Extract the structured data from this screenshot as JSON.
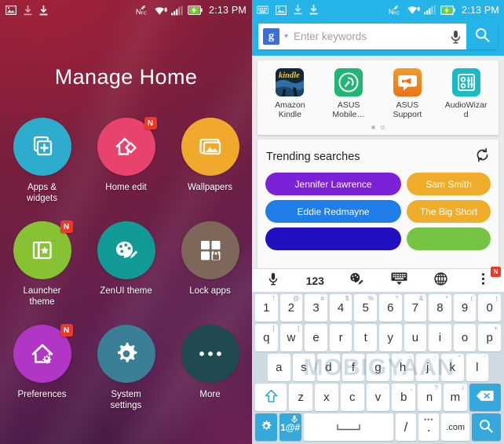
{
  "left_screen": {
    "status_bar": {
      "time": "2:13 PM",
      "left_icons": [
        "image-icon",
        "download-icon",
        "download-icon"
      ],
      "right_icons": [
        "nfc-icon",
        "wifi-icon",
        "signal-icon",
        "battery-charging-icon"
      ]
    },
    "page_title": "Manage Home",
    "tiles": [
      {
        "label": "Apps &\nwidgets",
        "label_line1": "Apps &",
        "label_line2": "widgets",
        "color": "#2eaccd",
        "icon": "add-widget-icon",
        "badge": ""
      },
      {
        "label": "Home edit",
        "label_line1": "Home edit",
        "label_line2": "",
        "color": "#e8436d",
        "icon": "home-edit-icon",
        "badge": "N"
      },
      {
        "label": "Wallpapers",
        "label_line1": "Wallpapers",
        "label_line2": "",
        "color": "#f0a92a",
        "icon": "wallpaper-icon",
        "badge": ""
      },
      {
        "label": "Launcher\ntheme",
        "label_line1": "Launcher",
        "label_line2": "theme",
        "color": "#86c232",
        "icon": "launcher-theme-icon",
        "badge": "N"
      },
      {
        "label": "ZenUI theme",
        "label_line1": "ZenUI theme",
        "label_line2": "",
        "color": "#119a96",
        "icon": "palette-icon",
        "badge": ""
      },
      {
        "label": "Lock apps",
        "label_line1": "Lock apps",
        "label_line2": "",
        "color": "#7d675a",
        "icon": "lock-apps-icon",
        "badge": ""
      },
      {
        "label": "Preferences",
        "label_line1": "Preferences",
        "label_line2": "",
        "color": "#b136c6",
        "icon": "home-settings-icon",
        "badge": "N"
      },
      {
        "label": "System\nsettings",
        "label_line1": "System",
        "label_line2": "settings",
        "color": "#3a7f95",
        "icon": "gear-icon",
        "badge": ""
      },
      {
        "label": "More",
        "label_line1": "More",
        "label_line2": "",
        "color": "#1f4a50",
        "icon": "more-dots-icon",
        "badge": ""
      }
    ]
  },
  "right_screen": {
    "status_bar": {
      "time": "2:13 PM",
      "left_icons": [
        "keyboard-icon",
        "image-icon",
        "download-icon",
        "download-icon"
      ],
      "right_icons": [
        "nfc-icon",
        "wifi-icon",
        "signal-icon",
        "battery-charging-icon"
      ],
      "background_color": "#24b4e8"
    },
    "search": {
      "engine_glyph": "g",
      "engine_badge_color": "#3b6fd4",
      "placeholder": "Enter keywords",
      "value": "",
      "mic_icon": "microphone-icon",
      "submit_icon": "search-icon",
      "dropdown_icon": "chevron-down-icon"
    },
    "app_shortcuts": {
      "items": [
        {
          "name_line1": "Amazon",
          "name_line2": "Kindle",
          "icon": "amazon-kindle-icon",
          "color": "#1b2a3c",
          "glyph": "kindle"
        },
        {
          "name_line1": "ASUS",
          "name_line2": "Mobile…",
          "icon": "asus-mobile-manager-icon",
          "color": "#22b573"
        },
        {
          "name_line1": "ASUS",
          "name_line2": "Support",
          "icon": "asus-support-icon",
          "color": "#f08421"
        },
        {
          "name_line1": "AudioWizar",
          "name_line2": "d",
          "icon": "audiowizard-icon",
          "color": "#19bcc4"
        }
      ],
      "page_dots": 2,
      "active_dot": 0
    },
    "trending": {
      "title": "Trending searches",
      "refresh_icon": "refresh-icon",
      "left_chips": [
        {
          "label": "Jennifer Lawrence",
          "color": "#7b22d8"
        },
        {
          "label": "Eddie Redmayne",
          "color": "#1f7ee8"
        },
        {
          "label": "",
          "color": "#2010c0"
        }
      ],
      "right_chips": [
        {
          "label": "Sam Smith",
          "color": "#f0ad2b"
        },
        {
          "label": "The Big Short",
          "color": "#f0ad2b"
        },
        {
          "label": "",
          "color": "#76c443"
        }
      ]
    },
    "keyboard": {
      "toolbar": [
        {
          "icon": "microphone-icon",
          "label": ""
        },
        {
          "icon": "numbers-icon",
          "label": "123"
        },
        {
          "icon": "theme-palette-icon",
          "label": ""
        },
        {
          "icon": "hide-keyboard-icon",
          "label": ""
        },
        {
          "icon": "globe-language-icon",
          "label": ""
        },
        {
          "icon": "overflow-menu-icon",
          "label": "",
          "badge": "N"
        }
      ],
      "row_numbers": [
        {
          "main": "1",
          "alt": "!"
        },
        {
          "main": "2",
          "alt": "@"
        },
        {
          "main": "3",
          "alt": "#"
        },
        {
          "main": "4",
          "alt": "$"
        },
        {
          "main": "5",
          "alt": "%"
        },
        {
          "main": "6",
          "alt": "^"
        },
        {
          "main": "7",
          "alt": "&"
        },
        {
          "main": "8",
          "alt": "*"
        },
        {
          "main": "9",
          "alt": "("
        },
        {
          "main": "0",
          "alt": ")"
        }
      ],
      "row_top": [
        {
          "main": "q",
          "alt": "["
        },
        {
          "main": "w",
          "alt": "]"
        },
        {
          "main": "e",
          "alt": ""
        },
        {
          "main": "r",
          "alt": ""
        },
        {
          "main": "t",
          "alt": ""
        },
        {
          "main": "y",
          "alt": ""
        },
        {
          "main": "u",
          "alt": ""
        },
        {
          "main": "i",
          "alt": ""
        },
        {
          "main": "o",
          "alt": ""
        },
        {
          "main": "p",
          "alt": "+"
        }
      ],
      "row_home": [
        {
          "main": "a",
          "alt": ""
        },
        {
          "main": "s",
          "alt": ""
        },
        {
          "main": "d",
          "alt": ""
        },
        {
          "main": "f",
          "alt": ""
        },
        {
          "main": "g",
          "alt": ""
        },
        {
          "main": "h",
          "alt": ":"
        },
        {
          "main": "j",
          "alt": ";"
        },
        {
          "main": "k",
          "alt": "\""
        },
        {
          "main": "l",
          "alt": "'"
        }
      ],
      "row_bottom": [
        {
          "main": "z",
          "alt": ""
        },
        {
          "main": "x",
          "alt": ""
        },
        {
          "main": "c",
          "alt": ""
        },
        {
          "main": "v",
          "alt": "-"
        },
        {
          "main": "b",
          "alt": ","
        },
        {
          "main": "n",
          "alt": "?"
        },
        {
          "main": "m",
          "alt": "/"
        }
      ],
      "shift_icon": "shift-up-icon",
      "backspace_icon": "backspace-icon",
      "row_space": {
        "settings_icon": "gear-icon",
        "symbols_label": "1@#",
        "symbols_mic_icon": "microphone-icon",
        "space_label": "",
        "slash_label": "/",
        "period_label": ".",
        "period_alt": "•••",
        "dotcom_label": ".com",
        "search_icon": "search-icon"
      }
    }
  },
  "watermark": {
    "text": "MOBIGYAAN"
  }
}
